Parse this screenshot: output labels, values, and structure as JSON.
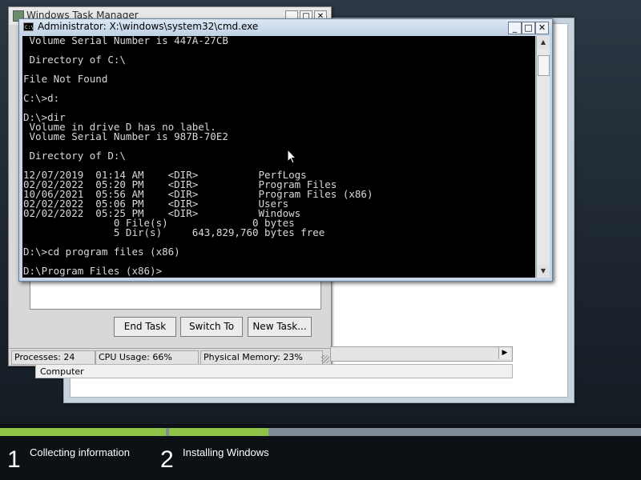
{
  "setup_progress": {
    "steps": [
      {
        "number": "1",
        "label": "Collecting information"
      },
      {
        "number": "2",
        "label": "Installing Windows"
      }
    ],
    "step1_complete": 1.0,
    "step2_progress": 0.21
  },
  "task_manager": {
    "title": "Windows Task Manager",
    "controls": {
      "minimize": "_",
      "maximize": "□",
      "close": "✕"
    },
    "buttons": {
      "end_task": "End Task",
      "switch_to": "Switch To",
      "new_task": "New Task..."
    },
    "status": {
      "processes": "Processes: 24",
      "cpu": "CPU Usage: 66%",
      "memory": "Physical Memory: 23%"
    }
  },
  "explorer": {
    "status_text": "Computer",
    "scroll_right_arrow": "▶"
  },
  "cmd": {
    "title": "Administrator: X:\\windows\\system32\\cmd.exe",
    "controls": {
      "minimize": "_",
      "maximize": "□",
      "close": "✕"
    },
    "scroll_up": "▲",
    "scroll_down": "▼",
    "output": " Volume Serial Number is 447A-27CB\n\n Directory of C:\\\n\nFile Not Found\n\nC:\\>d:\n\nD:\\>dir\n Volume in drive D has no label.\n Volume Serial Number is 987B-70E2\n\n Directory of D:\\\n\n12/07/2019  01:14 AM    <DIR>          PerfLogs\n02/02/2022  05:20 PM    <DIR>          Program Files\n10/06/2021  05:56 AM    <DIR>          Program Files (x86)\n02/02/2022  05:06 PM    <DIR>          Users\n02/02/2022  05:25 PM    <DIR>          Windows\n               0 File(s)              0 bytes\n               5 Dir(s)     643,829,760 bytes free\n\nD:\\>cd program files (x86)\n\nD:\\Program Files (x86)>"
  }
}
